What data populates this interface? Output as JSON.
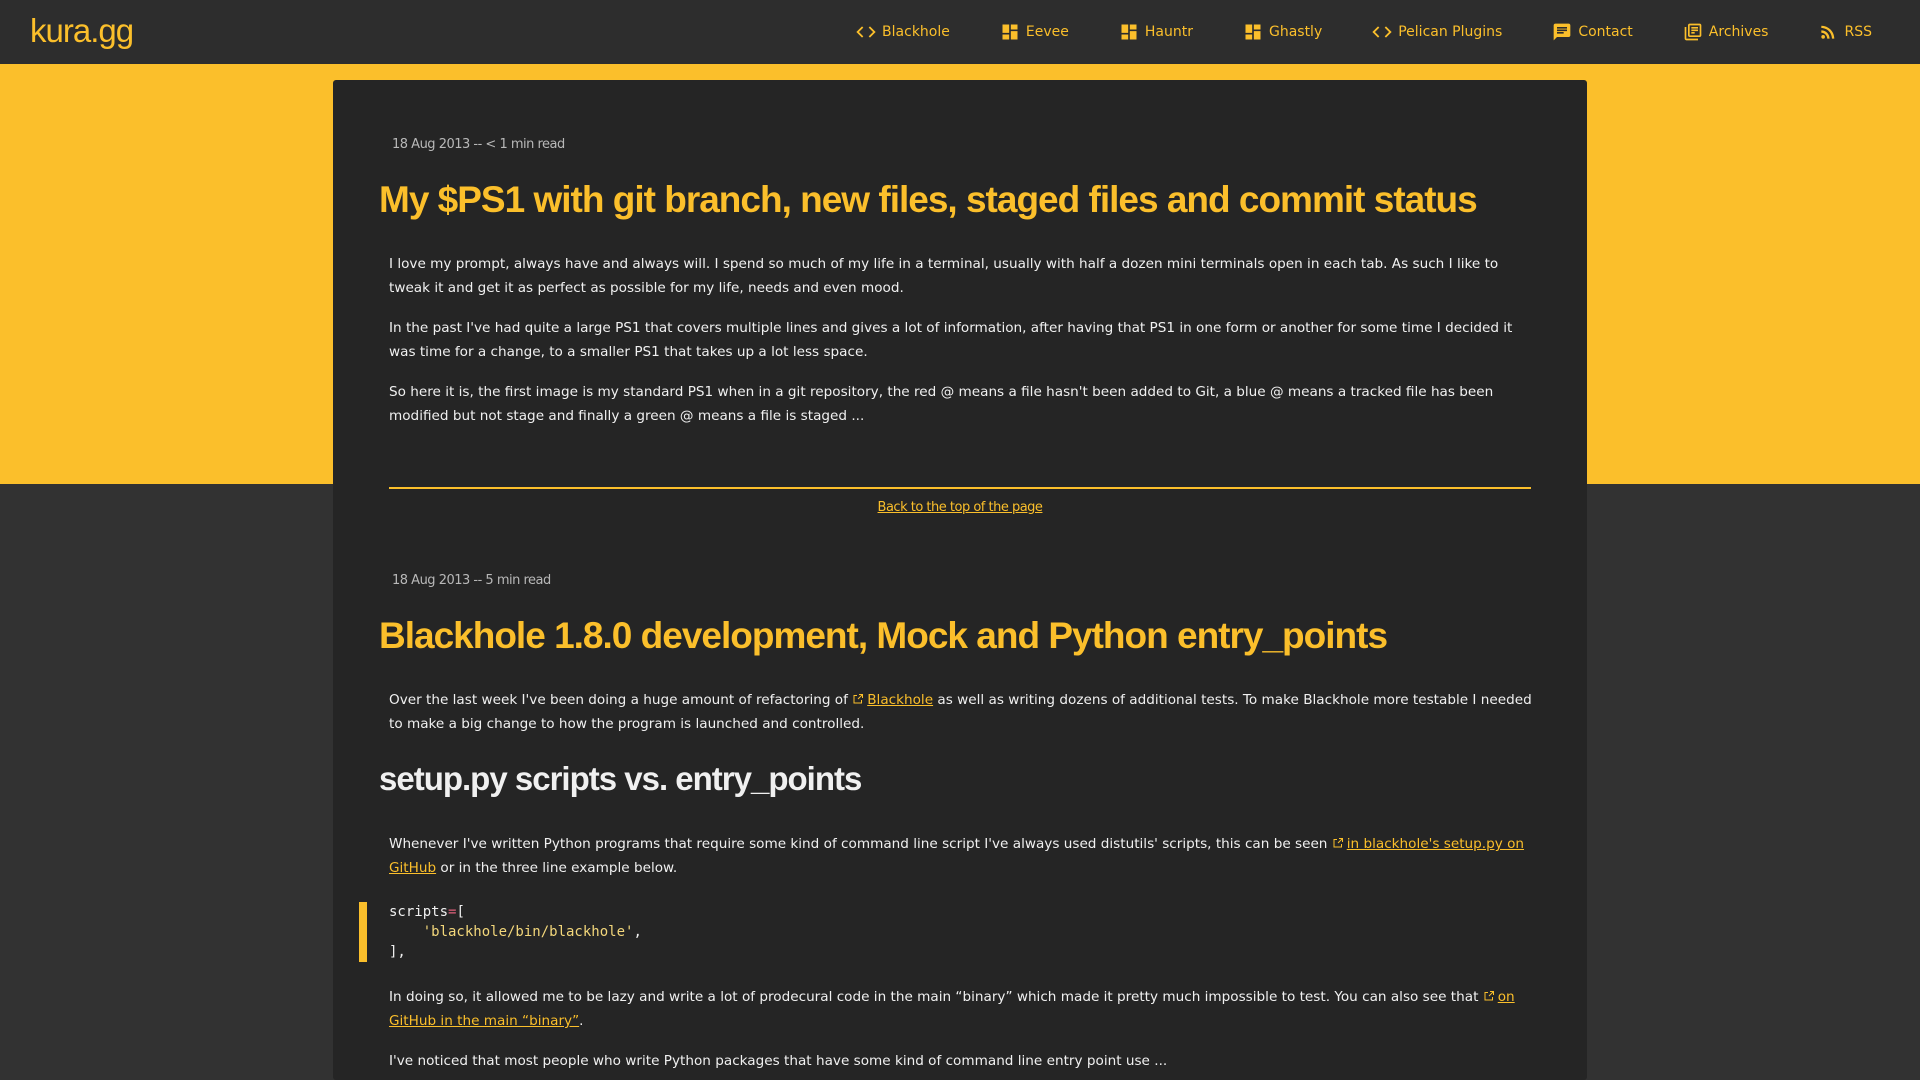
{
  "site": {
    "logo": "kura.gg"
  },
  "nav": [
    {
      "label": "Blackhole",
      "icon": "code-icon"
    },
    {
      "label": "Eevee",
      "icon": "dashboard-icon"
    },
    {
      "label": "Hauntr",
      "icon": "dashboard-icon"
    },
    {
      "label": "Ghastly",
      "icon": "dashboard-icon"
    },
    {
      "label": "Pelican Plugins",
      "icon": "code-icon"
    },
    {
      "label": "Contact",
      "icon": "chat-icon"
    },
    {
      "label": "Archives",
      "icon": "library-icon"
    },
    {
      "label": "RSS",
      "icon": "rss-icon"
    }
  ],
  "colors": {
    "accent": "#fbbf2b",
    "header_bg": "#2d2d2d",
    "page_bg": "#323232",
    "card_bg": "#252525"
  },
  "posts": [
    {
      "meta": "18 Aug 2013 -- < 1 min read",
      "title": "My $PS1 with git branch, new files, staged files and commit status",
      "paragraphs": [
        "I love my prompt, always have and always will. I spend so much of my life in a terminal, usually with half a dozen mini terminals open in each tab. As such I like to tweak it and get it as perfect as possible for my life, needs and even mood.",
        "In the past I've had quite a large PS1 that covers multiple lines and gives a lot of information, after having that PS1 in one form or another for some time I decided it was time for a change, to a smaller PS1 that takes up a lot less space.",
        "So here it is, the first image is my standard PS1 when in a git repository, the red @ means a file hasn't been added to Git, a blue @ means a tracked file has been modified but not stage and finally a green @ means a file is staged ..."
      ]
    },
    {
      "meta": "18 Aug 2013 -- 5 min read",
      "title": "Blackhole 1.8.0 development, Mock and Python entry_points",
      "p1_before": "Over the last week I've been doing a huge amount of refactoring of ",
      "p1_link": "Blackhole",
      "p1_after": " as well as writing dozens of additional tests. To make Blackhole more testable I needed to make a big change to how the program is launched and controlled.",
      "subheading": "setup.py scripts vs. entry_points",
      "p2_before": "Whenever I've written Python programs that require some kind of command line script I've always used distutils' scripts, this can be seen ",
      "p2_link": "in blackhole's setup.py on GitHub",
      "p2_after": " or in the three line example below.",
      "code": {
        "l1_ident": "scripts",
        "l1_op": "=",
        "l1_bracket": "[",
        "l2_indent": "    ",
        "l2_str": "'blackhole/bin/blackhole'",
        "l2_comma": ",",
        "l3": "],"
      },
      "p3_before": "In doing so, it allowed me to be lazy and write a lot of prodecural code in the main “binary” which made it pretty much impossible to test. You can also see that ",
      "p3_link": "on GitHub in the main “binary”",
      "p3_after": ".",
      "p4": "I've noticed that most people who write Python packages that have some kind of command line entry point use ..."
    }
  ],
  "back_to_top": "Back to the top of the page"
}
